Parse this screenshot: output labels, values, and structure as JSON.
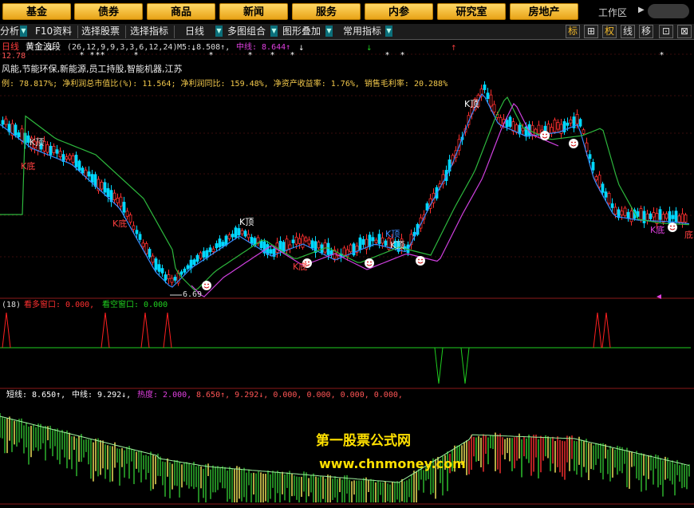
{
  "nav": {
    "items": [
      "基金",
      "债券",
      "商品",
      "新闻",
      "服务",
      "内参",
      "研究室",
      "房地产"
    ],
    "workzone_label": "工作区"
  },
  "toolbar": {
    "items": [
      "分析",
      "F10资料",
      "选择股票",
      "选择指标",
      "日线",
      "多图组合",
      "图形叠加",
      "常用指标"
    ],
    "right_buttons": [
      "标",
      "⊞",
      "权",
      "线",
      "移",
      "⊡",
      "⊠"
    ]
  },
  "main_panel": {
    "period_label": "日线",
    "indicator_name": "黄金波段",
    "indicator_params": "(26,12,9,9,3,3,6,12,24)",
    "m5_text": "M5: 8.508↑,",
    "midline_text": "中线: 8.644↑",
    "price_top_label": "12.78",
    "concept_text": "风能,节能环保,新能源,员工持股,智能机器,江苏",
    "finance_text": "例: 78.817%; 净利润总市值比(%): 11.564; 净利润同比: 159.48%, 净资产收益率: 1.76%, 销售毛利率: 20.288%",
    "low_label": "6.69",
    "labels": {
      "k_top": "K顶",
      "k_bottom": "K底",
      "bottom": "底"
    }
  },
  "mid_panel": {
    "param": "(18)",
    "bull_label": "看多窗口: 0.000,",
    "bear_label": "看空窗口: 0.000"
  },
  "low_panel": {
    "short_text": "短线: 8.650↑,",
    "mid_text": "中线: 9.292↓,",
    "heat_text": "热度: 2.000,",
    "vals_text": "8.650↑, 9.292↓, 0.000, 0.000, 0.000, 0.000,"
  },
  "watermark": {
    "line1": "第一股票公式网",
    "line2": "www.chnmoney.com"
  },
  "colors": {
    "up": "#ff3030",
    "down": "#00d8ff",
    "ma_fast": "#3a8cff",
    "ma_slow": "#2db83d",
    "ma_mid": "#d040e0",
    "nav_gold": "#f2b82a",
    "bull": "#ff2020",
    "bear": "#20d020"
  }
}
